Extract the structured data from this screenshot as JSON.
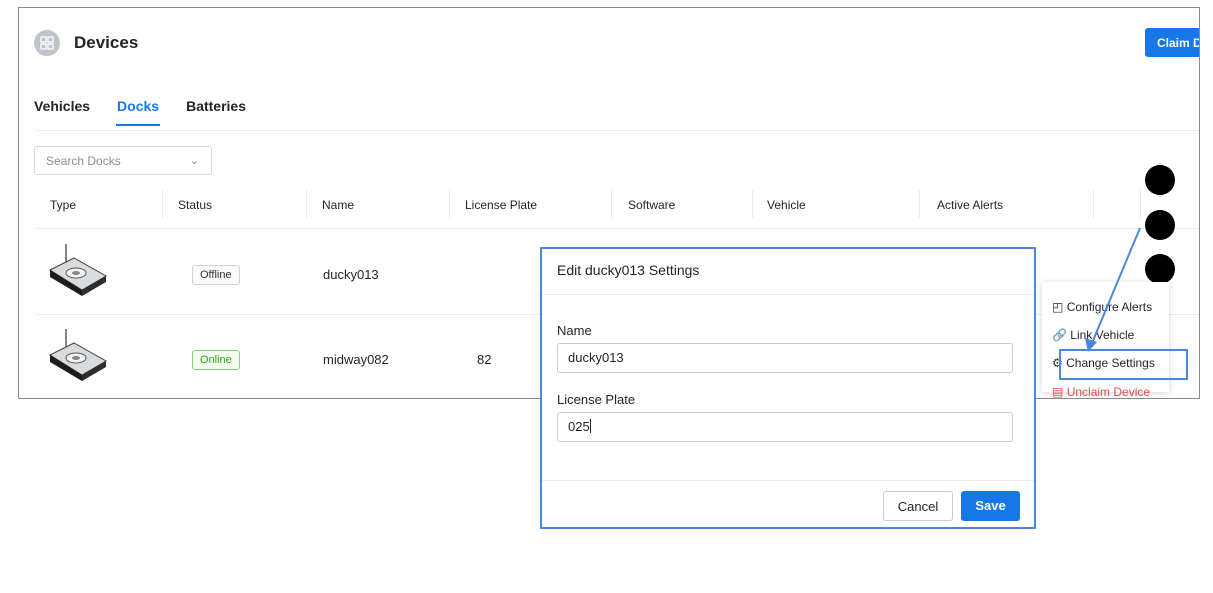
{
  "header": {
    "title": "Devices",
    "icon": "devices-icon",
    "claim_button_label": "Claim D"
  },
  "tabs": [
    {
      "label": "Vehicles",
      "active": false
    },
    {
      "label": "Docks",
      "active": true
    },
    {
      "label": "Batteries",
      "active": false
    }
  ],
  "search": {
    "placeholder": "Search Docks"
  },
  "table": {
    "columns": [
      "Type",
      "Status",
      "Name",
      "License Plate",
      "Software",
      "Vehicle",
      "Active Alerts"
    ],
    "rows": [
      {
        "status": "Offline",
        "name": "ducky013",
        "license_plate": ""
      },
      {
        "status": "Online",
        "name": "midway082",
        "license_plate": "82"
      }
    ]
  },
  "context_menu": {
    "items": [
      {
        "label": "Configure Alerts",
        "icon": "alarm-icon"
      },
      {
        "label": "Link Vehicle",
        "icon": "link-icon"
      },
      {
        "label": "Change Settings",
        "icon": "gear-icon"
      },
      {
        "label": "Unclaim Device",
        "icon": "unclaim-icon"
      }
    ]
  },
  "dialog": {
    "title": "Edit ducky013 Settings",
    "name_label": "Name",
    "name_value": "ducky013",
    "license_label": "License Plate",
    "license_value": "025",
    "cancel_label": "Cancel",
    "save_label": "Save"
  },
  "colors": {
    "accent": "#1677e8",
    "danger": "#e5484d",
    "annotation": "#4a87dc"
  }
}
